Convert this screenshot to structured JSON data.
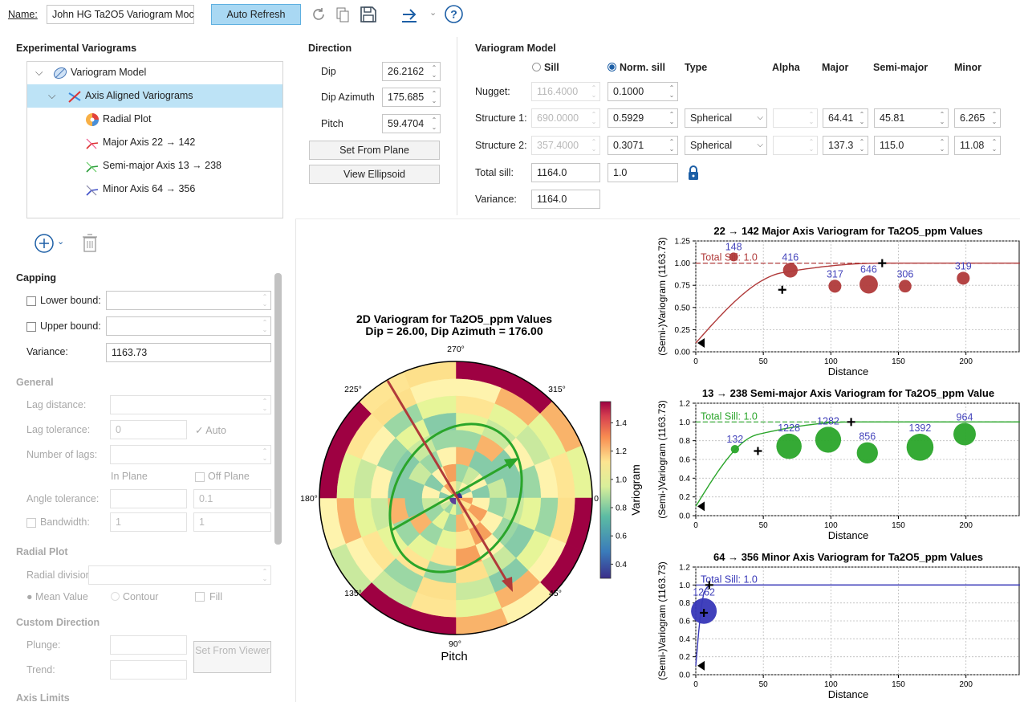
{
  "toolbar": {
    "name_label": "Name:",
    "name_value": "John HG Ta2O5 Variogram Moc",
    "auto_refresh": "Auto Refresh"
  },
  "tree": {
    "header": "Experimental Variograms",
    "items": [
      {
        "label": "Variogram Model"
      },
      {
        "label": "Axis Aligned Variograms"
      },
      {
        "label": "Radial Plot"
      },
      {
        "label": "Major Axis 22 → 142"
      },
      {
        "label": "Semi-major Axis 13 → 238"
      },
      {
        "label": "Minor Axis 64 → 356"
      }
    ]
  },
  "capping": {
    "header": "Capping",
    "lower": "Lower bound:",
    "upper": "Upper bound:",
    "variance_label": "Variance:",
    "variance_value": "1163.73"
  },
  "general": {
    "header": "General",
    "lag_distance": "Lag distance:",
    "lag_tolerance": "Lag tolerance:",
    "lag_tolerance_value": "0",
    "auto": "Auto",
    "number_of_lags": "Number of lags:",
    "in_plane": "In Plane",
    "off_plane": "Off Plane",
    "angle_tolerance": "Angle tolerance:",
    "angle_off": "0.1",
    "bandwidth": "Bandwidth:",
    "bandwidth_in": "1",
    "bandwidth_off": "1"
  },
  "radial": {
    "header": "Radial Plot",
    "divisions": "Radial divisions:",
    "mean": "Mean Value",
    "contour": "Contour",
    "fill": "Fill"
  },
  "custom": {
    "header": "Custom Direction",
    "plunge": "Plunge:",
    "trend": "Trend:",
    "set_from_viewer": "Set From Viewer"
  },
  "axis_limits": "Axis Limits",
  "direction": {
    "header": "Direction",
    "dip_label": "Dip",
    "dip": "26.2162",
    "dipaz_label": "Dip Azimuth",
    "dipaz": "175.685",
    "pitch_label": "Pitch",
    "pitch": "59.4704",
    "set_from_plane": "Set From Plane",
    "view_ellipsoid": "View Ellipsoid"
  },
  "model": {
    "header": "Variogram Model",
    "sill": "Sill",
    "norm_sill": "Norm. sill",
    "type": "Type",
    "alpha": "Alpha",
    "major": "Major",
    "semimajor": "Semi-major",
    "minor": "Minor",
    "nugget_label": "Nugget:",
    "nugget_sill": "116.4000",
    "nugget_norm": "0.1000",
    "s1_label": "Structure 1:",
    "s1_sill": "690.0000",
    "s1_norm": "0.5929",
    "s1_type": "Spherical",
    "s1_major": "64.41",
    "s1_semi": "45.81",
    "s1_minor": "6.265",
    "s2_label": "Structure 2:",
    "s2_sill": "357.4000",
    "s2_norm": "0.3071",
    "s2_type": "Spherical",
    "s2_major": "137.3",
    "s2_semi": "115.0",
    "s2_minor": "11.08",
    "total_label": "Total sill:",
    "total_sill": "1164.0",
    "total_norm": "1.0",
    "variance_label": "Variance:",
    "variance": "1164.0"
  },
  "colors": {
    "accent": "#1d5fa6",
    "selection": "#bde3f6",
    "major": "#b03a3a",
    "semi": "#2aa52a",
    "minor": "#3737b8",
    "label": "#4444bb"
  },
  "chart_data": [
    {
      "type": "heatmap",
      "title": "2D Variogram for Ta2O5_ppm Values",
      "subtitle": "Dip = 26.00, Dip Azimuth = 176.00",
      "xlabel": "Pitch",
      "angle_labels": [
        "270°",
        "315°",
        "0",
        "45°",
        "90°",
        "135°",
        "180°",
        "225°"
      ],
      "colorbar_label": "Variogram",
      "colorbar_ticks": [
        "1.4",
        "1.2",
        "1.0",
        "0.8",
        "0.6",
        "0.4"
      ],
      "colorbar_range": [
        0.3,
        1.55
      ]
    },
    {
      "type": "scatter",
      "title": "22 → 142 Major Axis Variogram for Ta2O5_ppm Values",
      "xlabel": "Distance",
      "ylabel": "(Semi-)Variogram (1163.73)",
      "xlim": [
        0,
        240
      ],
      "ylim": [
        0,
        1.25
      ],
      "xticks": [
        "0",
        "50",
        "100",
        "150",
        "200"
      ],
      "yticks": [
        "0.00",
        "0.25",
        "0.50",
        "0.75",
        "1.00",
        "1.25"
      ],
      "sill_label": "Total Sill: 1.0",
      "points": [
        {
          "x": 28,
          "y": 1.07,
          "n": "148"
        },
        {
          "x": 70,
          "y": 0.92,
          "n": "416"
        },
        {
          "x": 103,
          "y": 0.74,
          "n": "317"
        },
        {
          "x": 128,
          "y": 0.76,
          "n": "646"
        },
        {
          "x": 155,
          "y": 0.74,
          "n": "306"
        },
        {
          "x": 198,
          "y": 0.83,
          "n": "319"
        }
      ],
      "crosses": [
        {
          "x": 64,
          "y": 0.7
        },
        {
          "x": 138,
          "y": 1.0
        }
      ]
    },
    {
      "type": "scatter",
      "title": "13 → 238 Semi-major Axis Variogram for Ta2O5_ppm Value",
      "xlabel": "Distance",
      "ylabel": "(Semi-)Variogram (1163.73)",
      "xlim": [
        0,
        240
      ],
      "ylim": [
        0,
        1.2
      ],
      "xticks": [
        "0",
        "50",
        "100",
        "150",
        "200"
      ],
      "yticks": [
        "0.0",
        "0.2",
        "0.4",
        "0.6",
        "0.8",
        "1.0",
        "1.2"
      ],
      "sill_label": "Total Sill: 1.0",
      "points": [
        {
          "x": 29,
          "y": 0.71,
          "n": "132"
        },
        {
          "x": 69,
          "y": 0.74,
          "n": "1228"
        },
        {
          "x": 98,
          "y": 0.81,
          "n": "1282"
        },
        {
          "x": 127,
          "y": 0.67,
          "n": "856"
        },
        {
          "x": 166,
          "y": 0.73,
          "n": "1392"
        },
        {
          "x": 199,
          "y": 0.87,
          "n": "964"
        }
      ],
      "crosses": [
        {
          "x": 46,
          "y": 0.69
        },
        {
          "x": 115,
          "y": 1.0
        }
      ]
    },
    {
      "type": "scatter",
      "title": "64 → 356 Minor Axis Variogram for Ta2O5_ppm Values",
      "xlabel": "Distance",
      "ylabel": "(Semi-)Variogram (1163.73)",
      "xlim": [
        0,
        240
      ],
      "ylim": [
        0,
        1.2
      ],
      "xticks": [
        "0",
        "50",
        "100",
        "150",
        "200"
      ],
      "yticks": [
        "0.0",
        "0.2",
        "0.4",
        "0.6",
        "0.8",
        "1.0",
        "1.2"
      ],
      "sill_label": "Total Sill: 1.0",
      "points": [
        {
          "x": 6,
          "y": 0.71,
          "n": "1262"
        }
      ],
      "crosses": [
        {
          "x": 6,
          "y": 0.69
        },
        {
          "x": 10,
          "y": 1.0
        }
      ]
    }
  ]
}
